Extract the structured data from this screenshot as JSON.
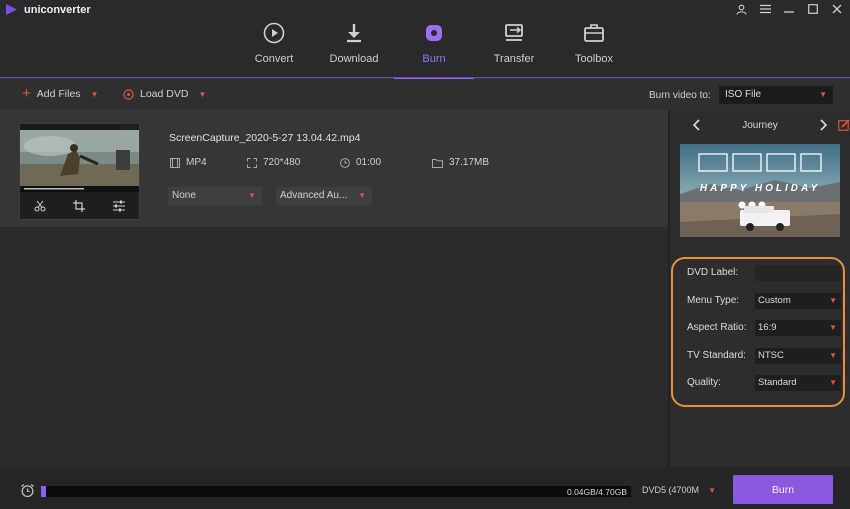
{
  "app": {
    "name": "uniconverter"
  },
  "nav": {
    "tabs": [
      {
        "label": "Convert",
        "icon": "play-circle-icon"
      },
      {
        "label": "Download",
        "icon": "download-icon"
      },
      {
        "label": "Burn",
        "icon": "disc-icon",
        "active": true
      },
      {
        "label": "Transfer",
        "icon": "transfer-icon"
      },
      {
        "label": "Toolbox",
        "icon": "toolbox-icon"
      }
    ]
  },
  "toolbar": {
    "add_files": "Add Files",
    "load_dvd": "Load DVD",
    "burn_to_label": "Burn video to:",
    "burn_to_value": "ISO File"
  },
  "file": {
    "name": "ScreenCapture_2020-5-27 13.04.42.mp4",
    "format": "MP4",
    "resolution": "720*480",
    "duration": "01:00",
    "size": "37.17MB",
    "subtitle": "None",
    "audio": "Advanced Au..."
  },
  "template": {
    "name": "Journey",
    "caption": "HAPPY HOLIDAY"
  },
  "settings": {
    "dvd_label": {
      "label": "DVD Label:",
      "value": ""
    },
    "menu_type": {
      "label": "Menu Type:",
      "value": "Custom"
    },
    "aspect_ratio": {
      "label": "Aspect Ratio:",
      "value": "16:9"
    },
    "tv_standard": {
      "label": "TV Standard:",
      "value": "NTSC"
    },
    "quality": {
      "label": "Quality:",
      "value": "Standard"
    }
  },
  "bottom": {
    "progress_text": "0.04GB/4.70GB",
    "progress_fraction": 0.0085,
    "disc_type": "DVD5 (4700M",
    "burn_label": "Burn"
  },
  "colors": {
    "accent": "#8e5ff0",
    "highlight_ring": "#e8913b",
    "caret": "#e5533d"
  }
}
